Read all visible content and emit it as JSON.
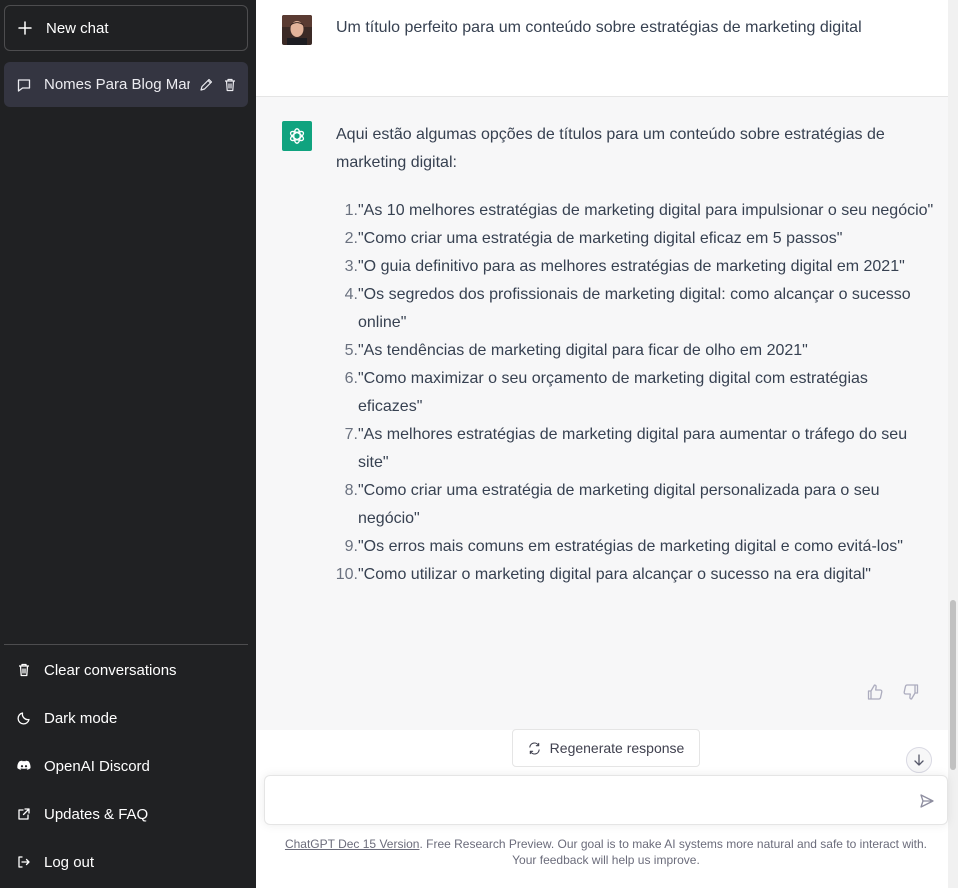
{
  "sidebar": {
    "new_chat_label": "New chat",
    "conversations": [
      {
        "label": "Nomes Para Blog Marketing"
      }
    ],
    "menu": [
      {
        "label": "Clear conversations",
        "icon": "trash-icon"
      },
      {
        "label": "Dark mode",
        "icon": "moon-icon"
      },
      {
        "label": "OpenAI Discord",
        "icon": "discord-icon"
      },
      {
        "label": "Updates & FAQ",
        "icon": "external-link-icon"
      },
      {
        "label": "Log out",
        "icon": "logout-icon"
      }
    ]
  },
  "chat": {
    "user_message": "Um título perfeito para um conteúdo sobre estratégias de marketing digital",
    "assistant_intro": "Aqui estão algumas opções de títulos para um conteúdo sobre estratégias de marketing digital:",
    "titles": [
      {
        "n": "1.",
        "text": "\"As 10 melhores estratégias de marketing digital para impulsionar o seu negócio\""
      },
      {
        "n": "2.",
        "text": "\"Como criar uma estratégia de marketing digital eficaz em 5 passos\""
      },
      {
        "n": "3.",
        "text": "\"O guia definitivo para as melhores estratégias de marketing digital em 2021\""
      },
      {
        "n": "4.",
        "text": "\"Os segredos dos profissionais de marketing digital: como alcançar o sucesso online\""
      },
      {
        "n": "5.",
        "text": "\"As tendências de marketing digital para ficar de olho em 2021\""
      },
      {
        "n": "6.",
        "text": "\"Como maximizar o seu orçamento de marketing digital com estratégias eficazes\""
      },
      {
        "n": "7.",
        "text": "\"As melhores estratégias de marketing digital para aumentar o tráfego do seu site\""
      },
      {
        "n": "8.",
        "text": "\"Como criar uma estratégia de marketing digital personalizada para o seu negócio\""
      },
      {
        "n": "9.",
        "text": "\"Os erros mais comuns em estratégias de marketing digital e como evitá-los\""
      },
      {
        "n": "10.",
        "text": "\"Como utilizar o marketing digital para alcançar o sucesso na era digital\""
      }
    ],
    "regenerate_label": "Regenerate response",
    "input_placeholder": ""
  },
  "footer": {
    "version_link": "ChatGPT Dec 15 Version",
    "note": ". Free Research Preview. Our goal is to make AI systems more natural and safe to interact with. Your feedback will help us improve."
  },
  "colors": {
    "sidebar_bg": "#202123",
    "active_item_bg": "#343541",
    "assistant_bg": "#f7f7f8",
    "brand_green": "#10a37f"
  }
}
